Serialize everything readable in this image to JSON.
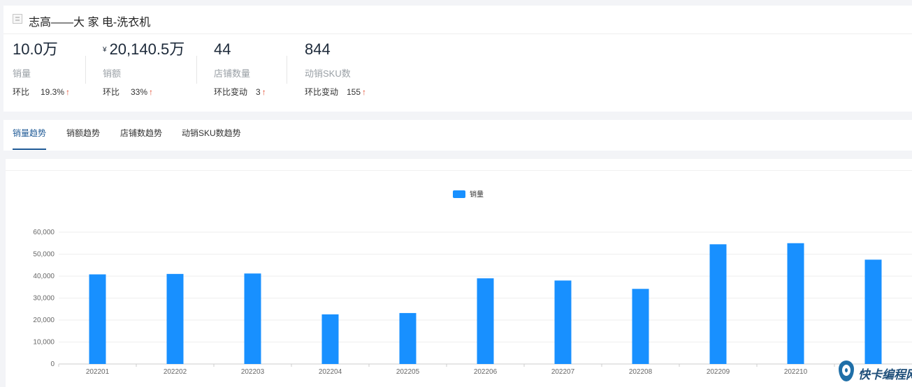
{
  "header": {
    "title": "志高——大 家 电-洗衣机"
  },
  "metrics": [
    {
      "value": "10.0万",
      "currency": "",
      "label": "销量",
      "change_label": "环比",
      "change_value": "19.3%",
      "arrow": "↑"
    },
    {
      "value": "20,140.5万",
      "currency": "¥",
      "label": "销额",
      "change_label": "环比",
      "change_value": "33%",
      "arrow": "↑"
    },
    {
      "value": "44",
      "currency": "",
      "label": "店铺数量",
      "change_label": "环比变动",
      "change_value": "3",
      "arrow": "↑"
    },
    {
      "value": "844",
      "currency": "",
      "label": "动销SKU数",
      "change_label": "环比变动",
      "change_value": "155",
      "arrow": "↑"
    }
  ],
  "tabs": [
    {
      "label": "销量趋势",
      "active": true
    },
    {
      "label": "销额趋势",
      "active": false
    },
    {
      "label": "店铺数趋势",
      "active": false
    },
    {
      "label": "动销SKU数趋势",
      "active": false
    }
  ],
  "chart_data": {
    "type": "bar",
    "categories": [
      "202201",
      "202202",
      "202203",
      "202204",
      "202205",
      "202206",
      "202207",
      "202208",
      "202209",
      "202210",
      ""
    ],
    "series": [
      {
        "name": "销量",
        "color": "#1890ff",
        "values": [
          40800,
          41000,
          41200,
          22600,
          23200,
          39000,
          38000,
          34200,
          54500,
          55000,
          47500
        ]
      }
    ],
    "ylim": [
      0,
      60000
    ],
    "yticks": [
      "0",
      "10,000",
      "20,000",
      "30,000",
      "40,000",
      "50,000",
      "60,000"
    ],
    "yticks_values": [
      0,
      10000,
      20000,
      30000,
      40000,
      50000,
      60000
    ],
    "grid": true,
    "legend": "top-center"
  },
  "watermark": {
    "text": "快卡编程网"
  }
}
